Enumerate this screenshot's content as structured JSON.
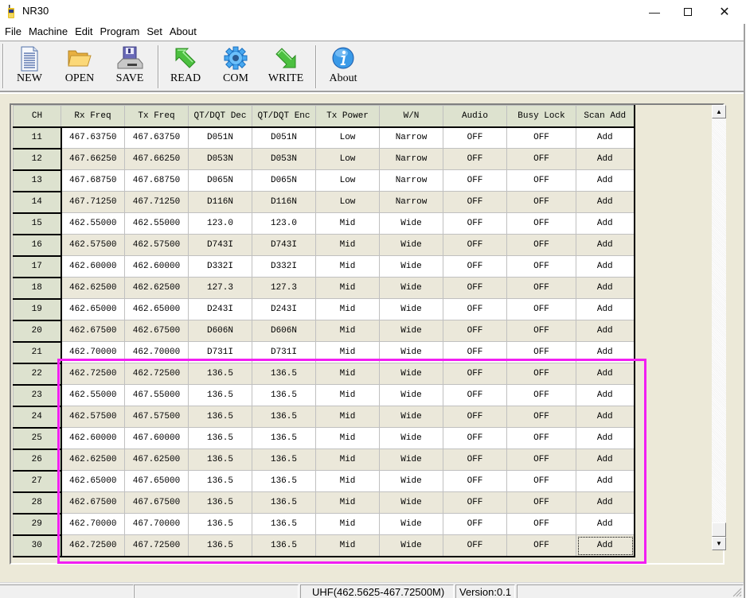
{
  "window": {
    "title": "NR30",
    "icon": "radio-icon",
    "controls": [
      "minimize-icon",
      "maximize-icon",
      "close-icon"
    ]
  },
  "menu": [
    "File",
    "Machine",
    "Edit",
    "Program",
    "Set",
    "About"
  ],
  "toolbar": {
    "new": "NEW",
    "open": "OPEN",
    "save": "SAVE",
    "read": "READ",
    "com": "COM",
    "write": "WRITE",
    "about": "About"
  },
  "grid": {
    "columns": [
      "CH",
      "Rx Freq",
      "Tx Freq",
      "QT/DQT Dec",
      "QT/DQT Enc",
      "Tx Power",
      "W/N",
      "Audio",
      "Busy Lock",
      "Scan Add"
    ],
    "rows": [
      [
        "11",
        "467.63750",
        "467.63750",
        "D051N",
        "D051N",
        "Low",
        "Narrow",
        "OFF",
        "OFF",
        "Add"
      ],
      [
        "12",
        "467.66250",
        "467.66250",
        "D053N",
        "D053N",
        "Low",
        "Narrow",
        "OFF",
        "OFF",
        "Add"
      ],
      [
        "13",
        "467.68750",
        "467.68750",
        "D065N",
        "D065N",
        "Low",
        "Narrow",
        "OFF",
        "OFF",
        "Add"
      ],
      [
        "14",
        "467.71250",
        "467.71250",
        "D116N",
        "D116N",
        "Low",
        "Narrow",
        "OFF",
        "OFF",
        "Add"
      ],
      [
        "15",
        "462.55000",
        "462.55000",
        "123.0",
        "123.0",
        "Mid",
        "Wide",
        "OFF",
        "OFF",
        "Add"
      ],
      [
        "16",
        "462.57500",
        "462.57500",
        "D743I",
        "D743I",
        "Mid",
        "Wide",
        "OFF",
        "OFF",
        "Add"
      ],
      [
        "17",
        "462.60000",
        "462.60000",
        "D332I",
        "D332I",
        "Mid",
        "Wide",
        "OFF",
        "OFF",
        "Add"
      ],
      [
        "18",
        "462.62500",
        "462.62500",
        "127.3",
        "127.3",
        "Mid",
        "Wide",
        "OFF",
        "OFF",
        "Add"
      ],
      [
        "19",
        "462.65000",
        "462.65000",
        "D243I",
        "D243I",
        "Mid",
        "Wide",
        "OFF",
        "OFF",
        "Add"
      ],
      [
        "20",
        "462.67500",
        "462.67500",
        "D606N",
        "D606N",
        "Mid",
        "Wide",
        "OFF",
        "OFF",
        "Add"
      ],
      [
        "21",
        "462.70000",
        "462.70000",
        "D731I",
        "D731I",
        "Mid",
        "Wide",
        "OFF",
        "OFF",
        "Add"
      ],
      [
        "22",
        "462.72500",
        "462.72500",
        "136.5",
        "136.5",
        "Mid",
        "Wide",
        "OFF",
        "OFF",
        "Add"
      ],
      [
        "23",
        "462.55000",
        "467.55000",
        "136.5",
        "136.5",
        "Mid",
        "Wide",
        "OFF",
        "OFF",
        "Add"
      ],
      [
        "24",
        "462.57500",
        "467.57500",
        "136.5",
        "136.5",
        "Mid",
        "Wide",
        "OFF",
        "OFF",
        "Add"
      ],
      [
        "25",
        "462.60000",
        "467.60000",
        "136.5",
        "136.5",
        "Mid",
        "Wide",
        "OFF",
        "OFF",
        "Add"
      ],
      [
        "26",
        "462.62500",
        "467.62500",
        "136.5",
        "136.5",
        "Mid",
        "Wide",
        "OFF",
        "OFF",
        "Add"
      ],
      [
        "27",
        "462.65000",
        "467.65000",
        "136.5",
        "136.5",
        "Mid",
        "Wide",
        "OFF",
        "OFF",
        "Add"
      ],
      [
        "28",
        "462.67500",
        "467.67500",
        "136.5",
        "136.5",
        "Mid",
        "Wide",
        "OFF",
        "OFF",
        "Add"
      ],
      [
        "29",
        "462.70000",
        "467.70000",
        "136.5",
        "136.5",
        "Mid",
        "Wide",
        "OFF",
        "OFF",
        "Add"
      ],
      [
        "30",
        "462.72500",
        "467.72500",
        "136.5",
        "136.5",
        "Mid",
        "Wide",
        "OFF",
        "OFF",
        "Add"
      ]
    ],
    "focused_cell": {
      "row": "30",
      "column": "Scan Add"
    },
    "highlighted_rows": [
      "22",
      "23",
      "24",
      "25",
      "26",
      "27",
      "28",
      "29",
      "30"
    ]
  },
  "colors": {
    "highlight_box": "#f21ef2",
    "header_bg": "#dde2cf",
    "row_alt_bg": "#ebe8da"
  },
  "statusbar": {
    "pane1": "",
    "pane2": "",
    "band": "UHF(462.5625-467.72500M)",
    "version": "Version:0.1",
    "pane5": ""
  }
}
